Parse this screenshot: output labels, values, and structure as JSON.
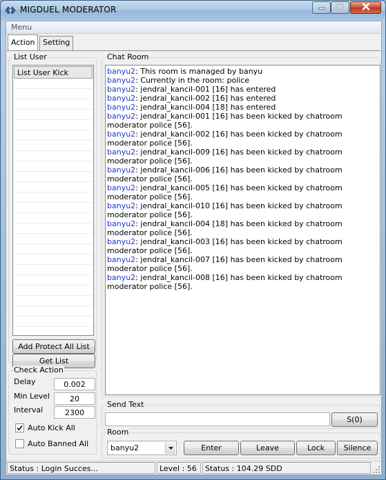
{
  "window": {
    "title": "MIGDUEL MODERATOR"
  },
  "menu": {
    "label": "Menu"
  },
  "tabs": [
    {
      "label": "Action"
    },
    {
      "label": "Setting"
    }
  ],
  "list_user": {
    "title": "List User",
    "column_header": "List User Kick",
    "rows": [],
    "add_protect_label": "Add Protect All List",
    "get_list_label": "Get List"
  },
  "check_action": {
    "title": "Check Action",
    "delay_label": "Delay",
    "delay_value": "0.002",
    "min_level_label": "Min Level",
    "min_level_value": "20",
    "interval_label": "Interval",
    "interval_value": "2300",
    "auto_kick_label": "Auto Kick All",
    "auto_kick_checked": true,
    "auto_banned_label": "Auto Banned All",
    "auto_banned_checked": false
  },
  "chat_room": {
    "title": "Chat Room",
    "messages": [
      {
        "nick": "banyu2",
        "text": ": This room is managed by banyu"
      },
      {
        "nick": "banyu2",
        "text": ": Currently in the room: police"
      },
      {
        "nick": "banyu2",
        "text": ": jendral_kancil-001 [16] has entered"
      },
      {
        "nick": "banyu2",
        "text": ": jendral_kancil-002 [16] has entered"
      },
      {
        "nick": "banyu2",
        "text": ": jendral_kancil-004 [18] has entered"
      },
      {
        "nick": "banyu2",
        "text": ": jendral_kancil-001 [16] has been kicked by chatroom moderator police [56]."
      },
      {
        "nick": "banyu2",
        "text": ": jendral_kancil-002 [16] has been kicked by chatroom moderator police [56]."
      },
      {
        "nick": "banyu2",
        "text": ": jendral_kancil-009 [16] has been kicked by chatroom moderator police [56]."
      },
      {
        "nick": "banyu2",
        "text": ": jendral_kancil-006 [16] has been kicked by chatroom moderator police [56]."
      },
      {
        "nick": "banyu2",
        "text": ": jendral_kancil-005 [16] has been kicked by chatroom moderator police [56]."
      },
      {
        "nick": "banyu2",
        "text": ": jendral_kancil-010 [16] has been kicked by chatroom moderator police [56]."
      },
      {
        "nick": "banyu2",
        "text": ": jendral_kancil-004 [18] has been kicked by chatroom moderator police [56]."
      },
      {
        "nick": "banyu2",
        "text": ": jendral_kancil-003 [16] has been kicked by chatroom moderator police [56]."
      },
      {
        "nick": "banyu2",
        "text": ": jendral_kancil-007 [16] has been kicked by chatroom moderator police [56]."
      },
      {
        "nick": "banyu2",
        "text": ": jendral_kancil-008 [16] has been kicked by chatroom moderator police [56]."
      }
    ]
  },
  "send_text": {
    "title": "Send Text",
    "value": "",
    "send_label": "S(0)"
  },
  "room": {
    "title": "Room",
    "selected": "banyu2",
    "enter_label": "Enter",
    "leave_label": "Leave",
    "lock_label": "Lock",
    "silence_label": "Silence"
  },
  "status_bar": {
    "status": "Status : Login Succes...",
    "level": "Level : 56",
    "balance": "Status : 104.29 SDD"
  },
  "colors": {
    "nick": "#1d37c7",
    "title_bar": "#a9c6e3",
    "close_button": "#c74d33"
  }
}
